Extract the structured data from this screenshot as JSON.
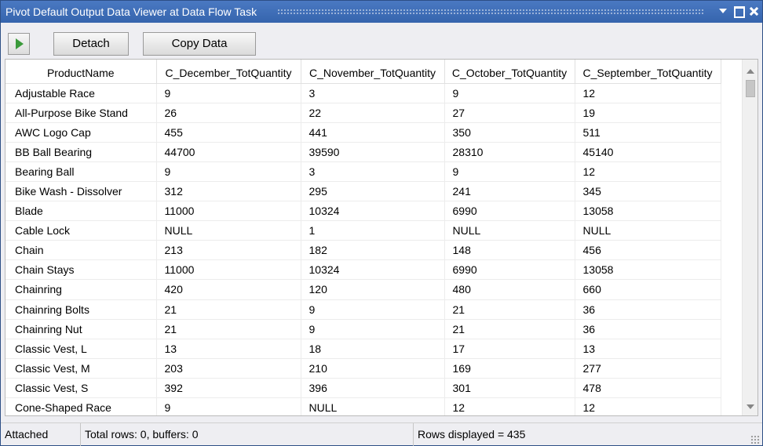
{
  "window": {
    "title": "Pivot Default Output Data Viewer at Data Flow Task"
  },
  "toolbar": {
    "play_icon": "play-icon",
    "detach_label": "Detach",
    "copy_label": "Copy Data"
  },
  "grid": {
    "columns": [
      "ProductName",
      "C_December_TotQuantity",
      "C_November_TotQuantity",
      "C_October_TotQuantity",
      "C_September_TotQuantity"
    ],
    "rows": [
      [
        "Adjustable Race",
        "9",
        "3",
        "9",
        "12"
      ],
      [
        "All-Purpose Bike Stand",
        "26",
        "22",
        "27",
        "19"
      ],
      [
        "AWC Logo Cap",
        "455",
        "441",
        "350",
        "511"
      ],
      [
        "BB Ball Bearing",
        "44700",
        "39590",
        "28310",
        "45140"
      ],
      [
        "Bearing Ball",
        "9",
        "3",
        "9",
        "12"
      ],
      [
        "Bike Wash - Dissolver",
        "312",
        "295",
        "241",
        "345"
      ],
      [
        "Blade",
        "11000",
        "10324",
        "6990",
        "13058"
      ],
      [
        "Cable Lock",
        "NULL",
        "1",
        "NULL",
        "NULL"
      ],
      [
        "Chain",
        "213",
        "182",
        "148",
        "456"
      ],
      [
        "Chain Stays",
        "11000",
        "10324",
        "6990",
        "13058"
      ],
      [
        "Chainring",
        "420",
        "120",
        "480",
        "660"
      ],
      [
        "Chainring Bolts",
        "21",
        "9",
        "21",
        "36"
      ],
      [
        "Chainring Nut",
        "21",
        "9",
        "21",
        "36"
      ],
      [
        "Classic Vest, L",
        "13",
        "18",
        "17",
        "13"
      ],
      [
        "Classic Vest, M",
        "203",
        "210",
        "169",
        "277"
      ],
      [
        "Classic Vest, S",
        "392",
        "396",
        "301",
        "478"
      ],
      [
        "Cone-Shaped Race",
        "9",
        "NULL",
        "12",
        "12"
      ]
    ]
  },
  "status": {
    "state": "Attached",
    "total": "Total rows: 0, buffers: 0",
    "displayed": "Rows displayed = 435"
  },
  "colors": {
    "titlebar": "#3b6bb5",
    "play_green": "#3a9a3a",
    "background": "#eeeef2"
  }
}
